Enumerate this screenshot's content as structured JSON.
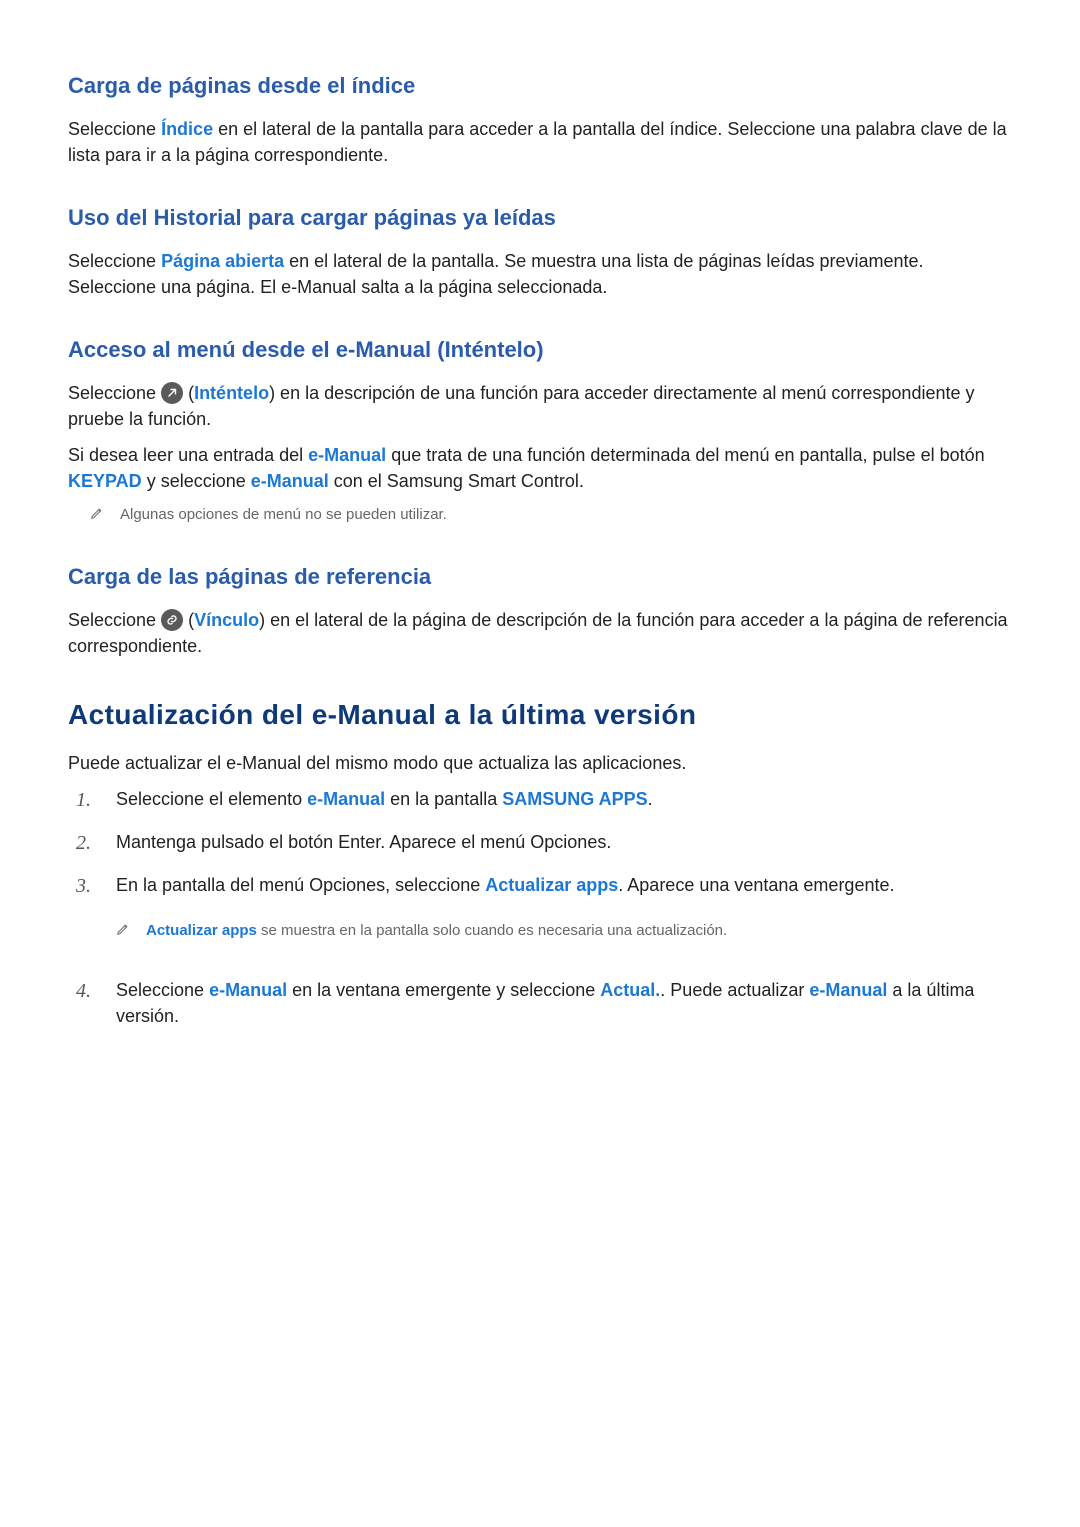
{
  "s1": {
    "title": "Carga de páginas desde el índice",
    "p1a": "Seleccione ",
    "kw1": "Índice",
    "p1b": " en el lateral de la pantalla para acceder a la pantalla del índice. Seleccione una palabra clave de la lista para ir a la página correspondiente."
  },
  "s2": {
    "title": "Uso del Historial para cargar páginas ya leídas",
    "p1a": "Seleccione ",
    "kw1": "Página abierta",
    "p1b": " en el lateral de la pantalla. Se muestra una lista de páginas leídas previamente. Seleccione una página. El e-Manual salta a la página seleccionada."
  },
  "s3": {
    "title": "Acceso al menú desde el e-Manual (Inténtelo)",
    "p1a": "Seleccione ",
    "paren_open": " (",
    "kw1": "Inténtelo",
    "p1b": ") en la descripción de una función para acceder directamente al menú correspondiente y pruebe la función.",
    "p2a": "Si desea leer una entrada del ",
    "kw2": "e-Manual",
    "p2b": " que trata de una función determinada del menú en pantalla, pulse el botón ",
    "kw3": "KEYPAD",
    "p2c": " y seleccione ",
    "kw4": "e-Manual",
    "p2d": " con el Samsung Smart Control.",
    "note": "Algunas opciones de menú no se pueden utilizar."
  },
  "s4": {
    "title": "Carga de las páginas de referencia",
    "p1a": "Seleccione ",
    "paren_open": " (",
    "kw1": "Vínculo",
    "p1b": ") en el lateral de la página de descripción de la función para acceder a la página de referencia correspondiente."
  },
  "s5": {
    "title": "Actualización del e-Manual a la última versión",
    "intro": "Puede actualizar el e-Manual del mismo modo que actualiza las aplicaciones.",
    "step1a": "Seleccione el elemento ",
    "step1k1": "e-Manual",
    "step1b": " en la pantalla ",
    "step1k2": "SAMSUNG APPS",
    "step1c": ".",
    "step2": "Mantenga pulsado el botón Enter. Aparece el menú Opciones.",
    "step3a": "En la pantalla del menú Opciones, seleccione ",
    "step3k1": "Actualizar apps",
    "step3b": ". Aparece una ventana emergente.",
    "note_k": "Actualizar apps",
    "note_b": " se muestra en la pantalla solo cuando es necesaria una actualización.",
    "step4a": "Seleccione ",
    "step4k1": "e-Manual",
    "step4b": " en la ventana emergente y seleccione ",
    "step4k2": "Actual.",
    "step4c": ". Puede actualizar ",
    "step4k3": "e-Manual",
    "step4d": " a la última versión."
  }
}
